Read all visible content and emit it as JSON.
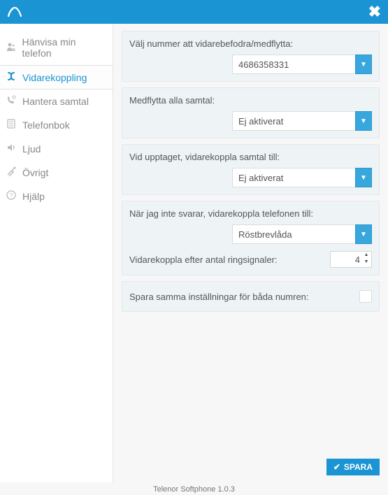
{
  "header": {
    "close_glyph": "✖"
  },
  "sidebar": {
    "items": [
      {
        "label": "Hänvisa min telefon",
        "icon": "user"
      },
      {
        "label": "Vidarekoppling",
        "icon": "forward",
        "active": true
      },
      {
        "label": "Hantera samtal",
        "icon": "phone"
      },
      {
        "label": "Telefonbok",
        "icon": "book"
      },
      {
        "label": "Ljud",
        "icon": "sound"
      },
      {
        "label": "Övrigt",
        "icon": "tools"
      },
      {
        "label": "Hjälp",
        "icon": "help"
      }
    ]
  },
  "main": {
    "forward_number": {
      "label": "Välj nummer att vidarebefodra/medflytta:",
      "value": "4686358331"
    },
    "move_all": {
      "label": "Medflytta alla samtal:",
      "value": "Ej aktiverat"
    },
    "busy": {
      "label": "Vid upptaget, vidarekoppla samtal till:",
      "value": "Ej aktiverat"
    },
    "no_answer": {
      "label": "När jag inte svarar, vidarekoppla telefonen till:",
      "value": "Röstbrevlåda",
      "rings_label": "Vidarekoppla efter antal ringsignaler:",
      "rings_value": "4"
    },
    "both_numbers": {
      "label": "Spara samma inställningar för båda numren:",
      "checked": false
    },
    "save_label": "SPARA"
  },
  "footer": {
    "version": "Telenor Softphone 1.0.3"
  }
}
